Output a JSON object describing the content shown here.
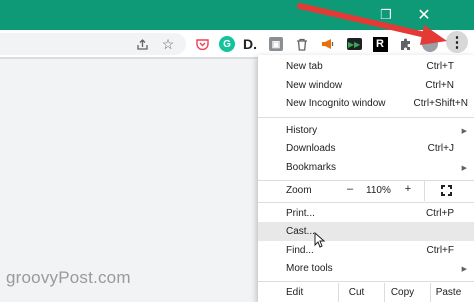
{
  "window": {
    "minimize_glyph": "—",
    "maximize_glyph": "❐",
    "close_glyph": "✕"
  },
  "toolbar": {
    "icons": [
      "share-icon",
      "star-icon",
      "pocket-icon",
      "grammarly-icon",
      "d-extension-icon",
      "box-extension-icon",
      "trash-icon",
      "megaphone-icon",
      "media-icon",
      "r-extension-icon",
      "puzzle-icon",
      "profile-icon",
      "more-menu-icon"
    ],
    "grammarly_letter": "G",
    "d_letter": "D.",
    "r_letter": "R",
    "menu_glyph": "⋮"
  },
  "menu": {
    "items_top": [
      {
        "label": "New tab",
        "shortcut": "Ctrl+T"
      },
      {
        "label": "New window",
        "shortcut": "Ctrl+N"
      },
      {
        "label": "New Incognito window",
        "shortcut": "Ctrl+Shift+N"
      }
    ],
    "items_mid": [
      {
        "label": "History",
        "submenu": true
      },
      {
        "label": "Downloads",
        "shortcut": "Ctrl+J"
      },
      {
        "label": "Bookmarks",
        "submenu": true
      }
    ],
    "zoom": {
      "label": "Zoom",
      "minus": "–",
      "value": "110%",
      "plus": "+"
    },
    "items_lower": [
      {
        "label": "Print...",
        "shortcut": "Ctrl+P"
      },
      {
        "label": "Cast...",
        "highlighted": true
      },
      {
        "label": "Find...",
        "shortcut": "Ctrl+F"
      },
      {
        "label": "More tools",
        "submenu": true
      }
    ],
    "edit": {
      "label": "Edit",
      "cut": "Cut",
      "copy": "Copy",
      "paste": "Paste"
    }
  },
  "colors": {
    "titlebar": "#0f9a77",
    "arrow": "#e53935"
  },
  "watermark": "groovyPost.com"
}
